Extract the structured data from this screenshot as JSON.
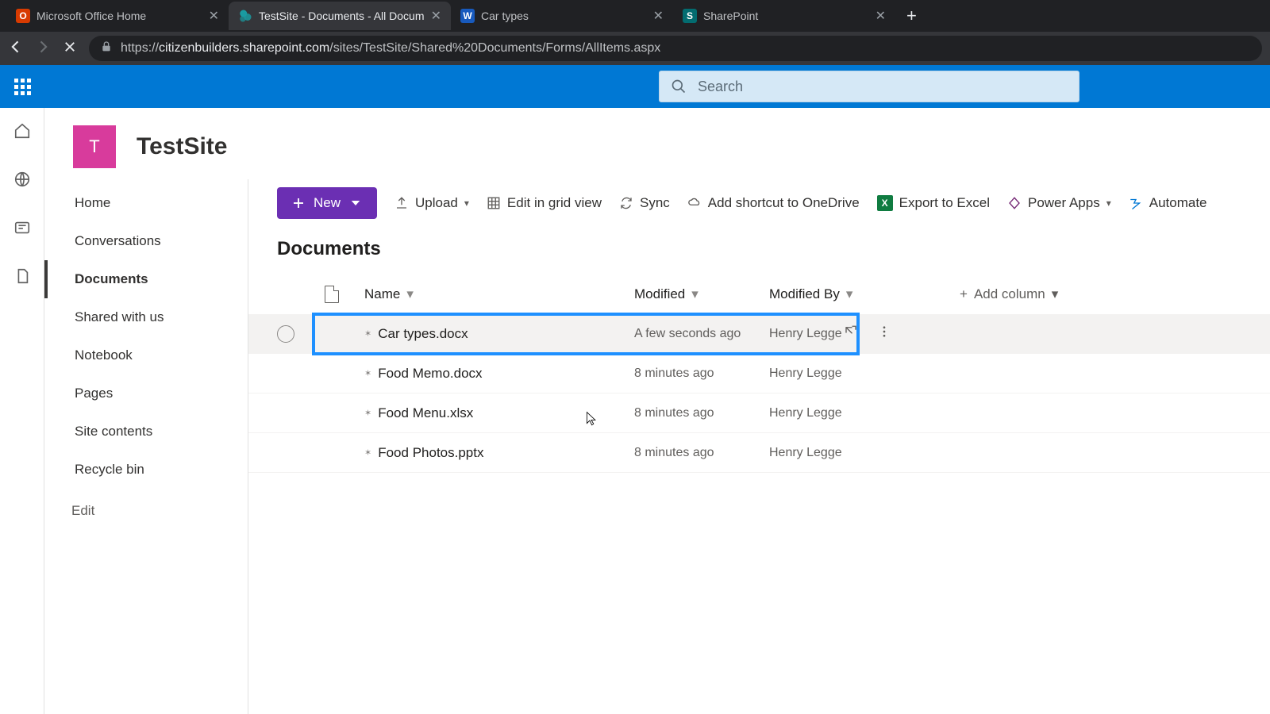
{
  "browser": {
    "tabs": [
      {
        "title": "Microsoft Office Home"
      },
      {
        "title": "TestSite - Documents - All Docum"
      },
      {
        "title": "Car types"
      },
      {
        "title": "SharePoint"
      }
    ],
    "url_prefix": "https://",
    "url_host": "citizenbuilders.sharepoint.com",
    "url_path": "/sites/TestSite/Shared%20Documents/Forms/AllItems.aspx"
  },
  "suite": {
    "search_placeholder": "Search"
  },
  "site": {
    "logo_letter": "T",
    "title": "TestSite"
  },
  "left_nav": {
    "items": [
      "Home",
      "Conversations",
      "Documents",
      "Shared with us",
      "Notebook",
      "Pages",
      "Site contents",
      "Recycle bin"
    ],
    "edit": "Edit"
  },
  "commands": {
    "new": "New",
    "upload": "Upload",
    "grid": "Edit in grid view",
    "sync": "Sync",
    "shortcut": "Add shortcut to OneDrive",
    "export": "Export to Excel",
    "powerapps": "Power Apps",
    "automate": "Automate"
  },
  "library": {
    "title": "Documents",
    "columns": {
      "name": "Name",
      "modified": "Modified",
      "modified_by": "Modified By",
      "add": "Add column"
    },
    "rows": [
      {
        "name": "Car types.docx",
        "modified": "A few seconds ago",
        "modified_by": "Henry Legge"
      },
      {
        "name": "Food Memo.docx",
        "modified": "8 minutes ago",
        "modified_by": "Henry Legge"
      },
      {
        "name": "Food Menu.xlsx",
        "modified": "8 minutes ago",
        "modified_by": "Henry Legge"
      },
      {
        "name": "Food Photos.pptx",
        "modified": "8 minutes ago",
        "modified_by": "Henry Legge"
      }
    ]
  }
}
